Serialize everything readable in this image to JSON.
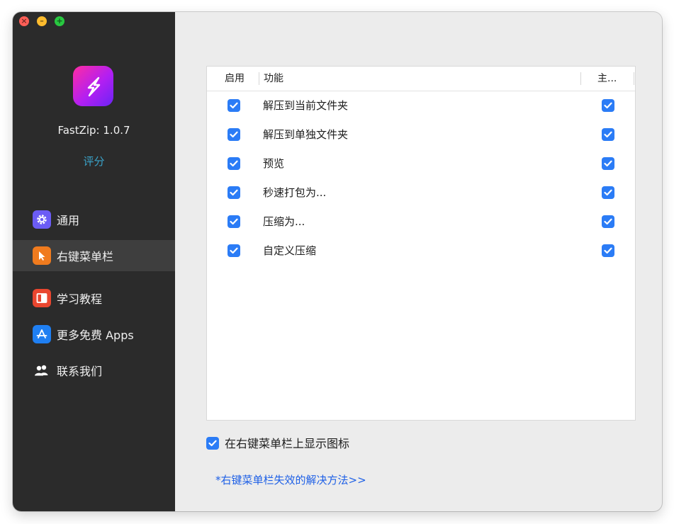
{
  "app": {
    "version_label": "FastZip: 1.0.7",
    "rate_label": "评分",
    "brand_color": "#b21ff2"
  },
  "sidebar": {
    "items": [
      {
        "label": "通用",
        "icon": "gear-icon",
        "icon_color": "#6b5cf5",
        "active": false
      },
      {
        "label": "右键菜单栏",
        "icon": "cursor-icon",
        "icon_color": "#f07b1e",
        "active": true
      },
      {
        "label": "学习教程",
        "icon": "book-icon",
        "icon_color": "#e9462f",
        "active": false
      },
      {
        "label": "更多免费 Apps",
        "icon": "app-store-icon",
        "icon_color": "#1f7ff2",
        "active": false
      },
      {
        "label": "联系我们",
        "icon": "people-icon",
        "icon_color": "#ffffff",
        "active": false
      }
    ]
  },
  "table": {
    "columns": [
      "启用",
      "功能",
      "主..."
    ],
    "rows": [
      {
        "enabled": true,
        "label": "解压到当前文件夹",
        "main": true
      },
      {
        "enabled": true,
        "label": "解压到单独文件夹",
        "main": true
      },
      {
        "enabled": true,
        "label": "预览",
        "main": true
      },
      {
        "enabled": true,
        "label": "秒速打包为...",
        "main": true
      },
      {
        "enabled": true,
        "label": "压缩为...",
        "main": true
      },
      {
        "enabled": true,
        "label": "自定义压缩",
        "main": true
      }
    ]
  },
  "options": {
    "show_icon_label": "在右键菜单栏上显示图标",
    "show_icon_checked": true
  },
  "help": {
    "link_label": "*右键菜单栏失效的解决方法>>"
  },
  "colors": {
    "accent": "#2b7cf6",
    "sidebar_bg": "#2b2b2b",
    "link": "#1d5fe6"
  }
}
